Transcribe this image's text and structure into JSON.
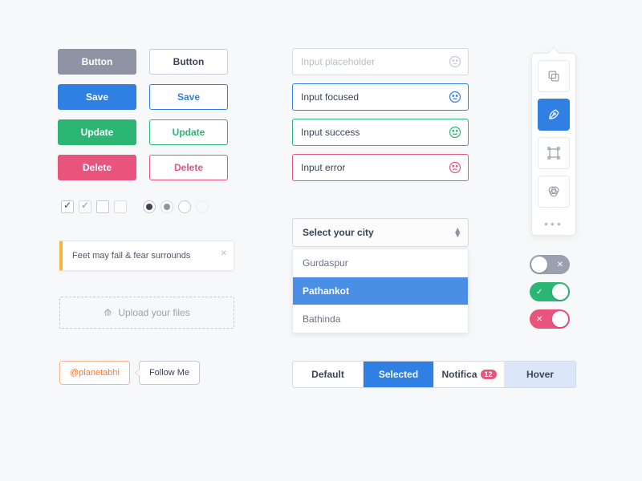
{
  "buttons": {
    "default": "Button",
    "default_outline": "Button",
    "save": "Save",
    "save_outline": "Save",
    "update": "Update",
    "update_outline": "Update",
    "delete": "Delete",
    "delete_outline": "Delete"
  },
  "inputs": {
    "placeholder": "Input placeholder",
    "focused": "Input focused",
    "success": "Input success",
    "error": "Input error"
  },
  "checkboxes": [
    {
      "checked": true,
      "muted": false
    },
    {
      "checked": true,
      "muted": true
    },
    {
      "checked": false,
      "muted": false
    },
    {
      "checked": false,
      "muted": true
    }
  ],
  "radios": [
    {
      "on": true,
      "opacity": "full"
    },
    {
      "on": true,
      "opacity": "dim"
    },
    {
      "on": false,
      "opacity": "full"
    },
    {
      "on": false,
      "opacity": "faint"
    }
  ],
  "alert": {
    "text": "Feet may fail & fear surrounds"
  },
  "dropzone": {
    "label": "Upload your files"
  },
  "handle": {
    "username": "@planetabhi",
    "follow_label": "Follow Me"
  },
  "select": {
    "placeholder": "Select your city",
    "options": [
      "Gurdaspur",
      "Pathankot",
      "Bathinda"
    ],
    "selected_index": 1
  },
  "segments": {
    "default": "Default",
    "selected": "Selected",
    "notification": "Notifica",
    "notification_count": "12",
    "hover": "Hover"
  },
  "palette": {
    "tools": [
      "layers",
      "pen",
      "transform",
      "filters"
    ],
    "active_index": 1
  },
  "toggles": [
    {
      "state": "off",
      "color": "gray",
      "mark": "✕"
    },
    {
      "state": "on",
      "color": "green",
      "mark": "✓"
    },
    {
      "state": "on",
      "color": "red",
      "mark": "✕"
    }
  ],
  "colors": {
    "blue": "#307fe2",
    "green": "#2bb673",
    "red": "#e8547c",
    "orange": "#ff7a3c",
    "amber": "#f9b43a",
    "gray": "#8e94a3"
  }
}
